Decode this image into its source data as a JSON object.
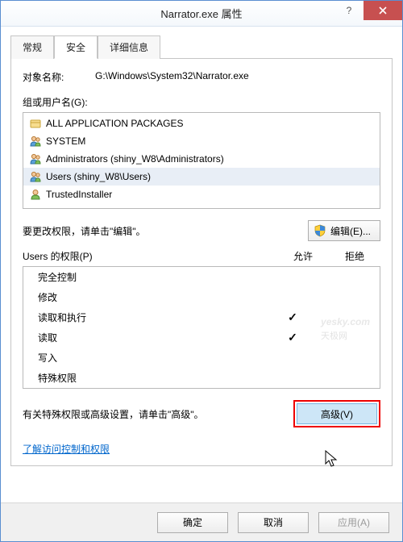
{
  "window": {
    "title": "Narrator.exe 属性"
  },
  "tabs": {
    "general": "常规",
    "security": "安全",
    "details": "详细信息"
  },
  "object": {
    "label": "对象名称:",
    "value": "G:\\Windows\\System32\\Narrator.exe"
  },
  "groups": {
    "label": "组或用户名(G):",
    "items": [
      {
        "name": "ALL APPLICATION PACKAGES",
        "icon": "package"
      },
      {
        "name": "SYSTEM",
        "icon": "users"
      },
      {
        "name": "Administrators (shiny_W8\\Administrators)",
        "icon": "users"
      },
      {
        "name": "Users (shiny_W8\\Users)",
        "icon": "users",
        "selected": true
      },
      {
        "name": "TrustedInstaller",
        "icon": "user"
      }
    ]
  },
  "editRow": {
    "text": "要更改权限，请单击\"编辑\"。",
    "button": "编辑(E)..."
  },
  "perm": {
    "header": {
      "whose": "Users 的权限(P)",
      "allow": "允许",
      "deny": "拒绝"
    },
    "rows": [
      {
        "label": "完全控制",
        "allow": "",
        "deny": ""
      },
      {
        "label": "修改",
        "allow": "",
        "deny": ""
      },
      {
        "label": "读取和执行",
        "allow": "✓",
        "deny": ""
      },
      {
        "label": "读取",
        "allow": "✓",
        "deny": ""
      },
      {
        "label": "写入",
        "allow": "",
        "deny": ""
      },
      {
        "label": "特殊权限",
        "allow": "",
        "deny": ""
      }
    ]
  },
  "advanced": {
    "text": "有关特殊权限或高级设置，请单击\"高级\"。",
    "button": "高级(V)"
  },
  "link": "了解访问控制和权限",
  "footer": {
    "ok": "确定",
    "cancel": "取消",
    "apply": "应用(A)"
  },
  "watermark": {
    "main": "yesky",
    "dot": ".com",
    "sub": "天极网"
  }
}
